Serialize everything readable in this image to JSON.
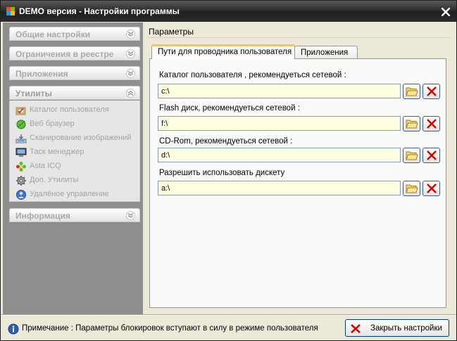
{
  "window": {
    "title": "DEMO версия - Настройки программы"
  },
  "sidebar": {
    "groups": [
      {
        "label": "Общие настройки",
        "state": "collapsed"
      },
      {
        "label": "Ограничения в реестре",
        "state": "collapsed"
      },
      {
        "label": "Приложения",
        "state": "collapsed"
      },
      {
        "label": "Утилиты",
        "state": "expanded"
      },
      {
        "label": "Информация",
        "state": "collapsed"
      }
    ],
    "utilities": [
      {
        "label": "Каталог пользователя",
        "icon": "folder-check-icon"
      },
      {
        "label": "Веб браузер",
        "icon": "leaf-icon"
      },
      {
        "label": "Сканирование изображений",
        "icon": "scanner-icon"
      },
      {
        "label": "Таск менеджер",
        "icon": "monitor-icon"
      },
      {
        "label": "Asta ICQ",
        "icon": "flower-icon"
      },
      {
        "label": "Доп. Утилиты",
        "icon": "gear-icon"
      },
      {
        "label": "Удалёное управление",
        "icon": "user-globe-icon"
      }
    ]
  },
  "main": {
    "section_title": "Параметры",
    "tabs": [
      {
        "label": "Пути для проводника пользователя",
        "active": true
      },
      {
        "label": "Приложения",
        "active": false
      }
    ],
    "fields": [
      {
        "label": "Каталог пользователя , рекомендуеться сетевой :",
        "value": "c:\\"
      },
      {
        "label": "Flash диск, рекомендуеться сетевой :",
        "value": "f:\\"
      },
      {
        "label": "CD-Rom, рекомендуеться сетевой :",
        "value": "d:\\"
      },
      {
        "label": "Разрешить использовать дискету",
        "value": "a:\\"
      }
    ]
  },
  "statusbar": {
    "note": "Примечание : Параметры блокировок вступают в силу в режиме пользователя",
    "close_settings_label": "Закрыть настройки"
  },
  "colors": {
    "input_background": "#ffffe1",
    "sidebar_background": "#8e8e8e",
    "delete_red": "#d40000"
  }
}
